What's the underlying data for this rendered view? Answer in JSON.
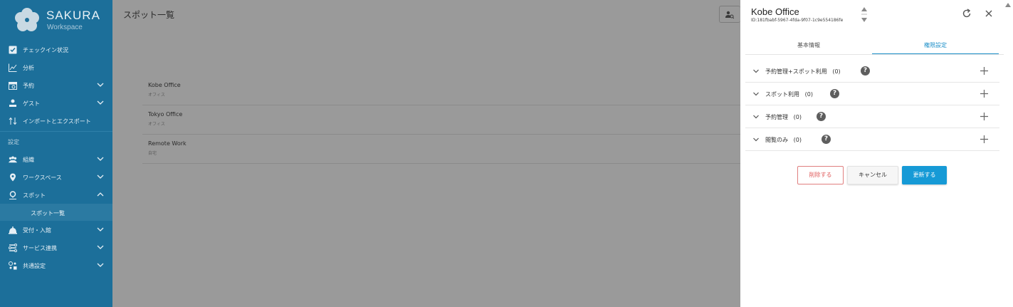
{
  "sidebar": {
    "brand": "SAKURA",
    "brand_sub": "Workspace",
    "items": [
      {
        "label": "チェックイン状況",
        "icon": "checkbox-icon"
      },
      {
        "label": "分析",
        "icon": "chart-line-icon"
      },
      {
        "label": "予約",
        "icon": "calendar-icon"
      },
      {
        "label": "ゲスト",
        "icon": "guest-icon"
      },
      {
        "label": "インポートとエクスポート",
        "icon": "import-export-icon"
      }
    ],
    "section_label": "設定",
    "settings_items": [
      {
        "label": "組織",
        "icon": "people-icon"
      },
      {
        "label": "ワークスペース",
        "icon": "location-pin-icon"
      },
      {
        "label": "スポット",
        "icon": "spot-pin-icon"
      },
      {
        "label": "受付・入館",
        "icon": "bell-icon"
      },
      {
        "label": "サービス連携",
        "icon": "integration-icon"
      },
      {
        "label": "共通設定",
        "icon": "settings-shapes-icon"
      }
    ],
    "active_sub_item": "スポット一覧"
  },
  "main": {
    "title": "スポット一覧",
    "rows": [
      {
        "name": "Kobe Office",
        "type": "オフィス"
      },
      {
        "name": "Tokyo Office",
        "type": "オフィス"
      },
      {
        "name": "Remote Work",
        "type": "自宅"
      }
    ]
  },
  "panel": {
    "title": "Kobe Office",
    "id": "ID:181fbabf-5967-4fda-9f07-1c9e554186fe",
    "tabs": [
      "基本情報",
      "権限設定"
    ],
    "active_tab": "権限設定",
    "sections": [
      {
        "label": "予約管理+スポット利用",
        "count": "(0)"
      },
      {
        "label": "スポット利用",
        "count": "(0)"
      },
      {
        "label": "予約管理",
        "count": "(0)"
      },
      {
        "label": "閲覧のみ",
        "count": "(0)"
      }
    ],
    "buttons": {
      "delete": "削除する",
      "cancel": "キャンセル",
      "update": "更新する"
    }
  },
  "colors": {
    "sidebar": "#1c6f9a",
    "accent": "#169ad6",
    "danger": "#e05d5d",
    "overlay": "#9a9a9a"
  }
}
